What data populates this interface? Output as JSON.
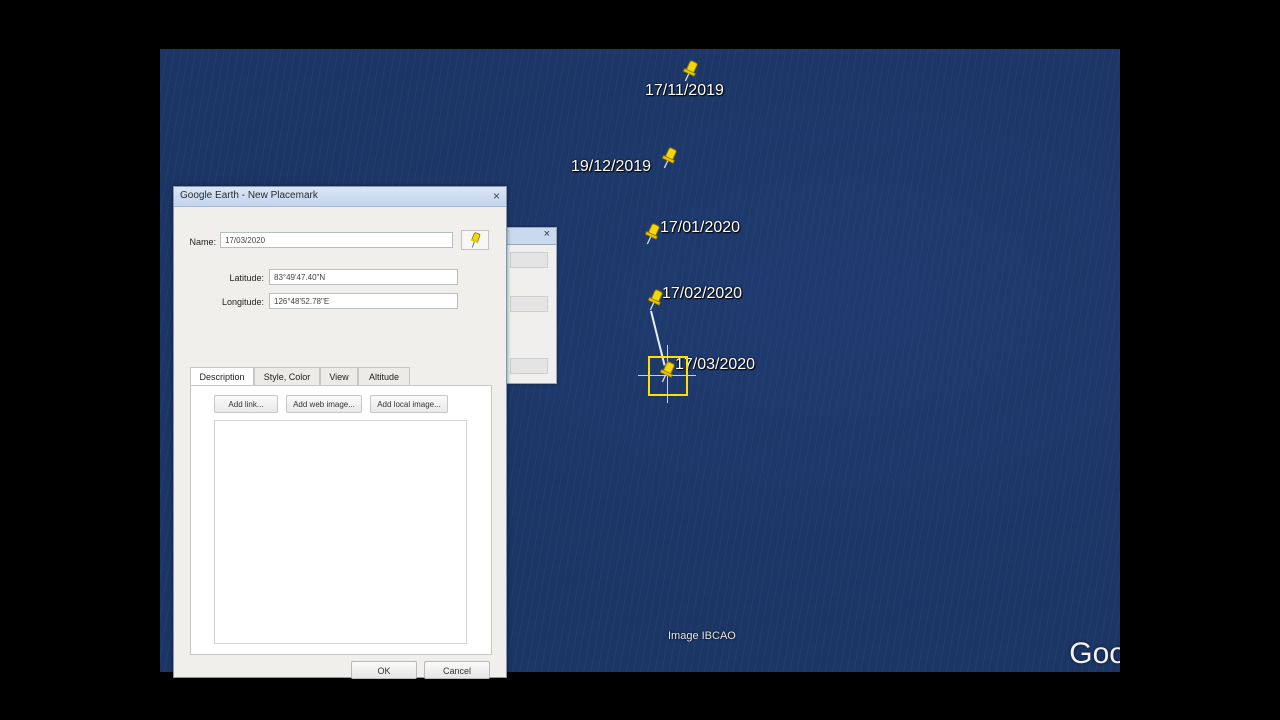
{
  "map": {
    "placemarks": [
      {
        "label": "17/11/2019"
      },
      {
        "label": "19/12/2019"
      },
      {
        "label": "17/01/2020"
      },
      {
        "label": "17/02/2020"
      },
      {
        "label": "17/03/2020"
      }
    ],
    "attribution": "Image IBCAO",
    "logo_text": "Goo",
    "pin_icon": "yellow-pushpin-icon",
    "pin_color": "#f3d60c",
    "ocean_color": "#1b3565"
  },
  "dialog": {
    "title": "Google Earth - New Placemark",
    "close_glyph": "×",
    "name_label": "Name:",
    "name_value": "17/03/2020",
    "latitude_label": "Latitude:",
    "latitude_value": "83°49'47.40\"N",
    "longitude_label": "Longitude:",
    "longitude_value": "126°48'52.78\"E",
    "tabs": [
      {
        "label": "Description"
      },
      {
        "label": "Style, Color"
      },
      {
        "label": "View"
      },
      {
        "label": "Altitude"
      }
    ],
    "buttons": {
      "add_link": "Add link...",
      "add_web_image": "Add web image...",
      "add_local_image": "Add local image..."
    },
    "ok_label": "OK",
    "cancel_label": "Cancel"
  }
}
